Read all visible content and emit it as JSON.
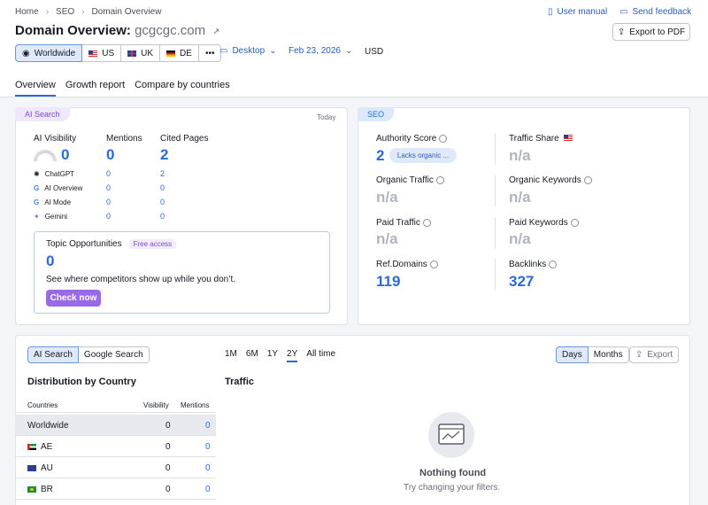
{
  "breadcrumb": [
    "Home",
    "SEO",
    "Domain Overview"
  ],
  "header": {
    "user_manual": "User manual",
    "send_feedback": "Send feedback",
    "title": "Domain Overview:",
    "domain": "gcgcgc.com",
    "export_pdf": "Export to PDF"
  },
  "databases": [
    {
      "label": "Worldwide",
      "icon": "globe-icon"
    },
    {
      "label": "US",
      "icon": "flag-us"
    },
    {
      "label": "UK",
      "icon": "flag-uk"
    },
    {
      "label": "DE",
      "icon": "flag-de"
    }
  ],
  "filters": {
    "device": "Desktop",
    "date": "Feb 23, 2026",
    "currency": "USD"
  },
  "tabs": [
    "Overview",
    "Growth report",
    "Compare by countries"
  ],
  "ai_search": {
    "tag": "AI Search",
    "today": "Today",
    "visibility_label": "AI Visibility",
    "visibility_value": "0",
    "mentions_label": "Mentions",
    "mentions_value": "0",
    "cited_label": "Cited Pages",
    "cited_value": "2",
    "sources": [
      {
        "name": "ChatGPT",
        "mentions": "0",
        "cited": "2"
      },
      {
        "name": "AI Overview",
        "mentions": "0",
        "cited": "0"
      },
      {
        "name": "AI Mode",
        "mentions": "0",
        "cited": "0"
      },
      {
        "name": "Gemini",
        "mentions": "0",
        "cited": "0"
      }
    ],
    "topic": {
      "title": "Topic Opportunities",
      "badge": "Free access",
      "value": "0",
      "desc": "See where competitors show up while you don’t.",
      "cta": "Check now"
    }
  },
  "seo": {
    "tag": "SEO",
    "authority_label": "Authority Score",
    "authority_value": "2",
    "authority_badge": "Lacks organic ...",
    "traffic_share_label": "Traffic Share",
    "traffic_share_value": "n/a",
    "organic_traffic_label": "Organic Traffic",
    "organic_traffic_value": "n/a",
    "organic_keywords_label": "Organic Keywords",
    "organic_keywords_value": "n/a",
    "paid_traffic_label": "Paid Traffic",
    "paid_traffic_value": "n/a",
    "paid_keywords_label": "Paid Keywords",
    "paid_keywords_value": "n/a",
    "ref_domains_label": "Ref.Domains",
    "ref_domains_value": "119",
    "backlinks_label": "Backlinks",
    "backlinks_value": "327"
  },
  "bottom": {
    "source_toggle": [
      "AI Search",
      "Google Search"
    ],
    "periods": [
      "1M",
      "6M",
      "1Y",
      "2Y",
      "All time"
    ],
    "granularity": [
      "Days",
      "Months"
    ],
    "export": "Export",
    "distribution_title": "Distribution by Country",
    "traffic_title": "Traffic",
    "columns": [
      "Countries",
      "Visibility",
      "Mentions"
    ],
    "rows": [
      {
        "country": "Worldwide",
        "flag": "",
        "visibility": "0",
        "mentions": "0"
      },
      {
        "country": "AE",
        "flag": "flag-ae",
        "visibility": "0",
        "mentions": "0"
      },
      {
        "country": "AU",
        "flag": "flag-au",
        "visibility": "0",
        "mentions": "0"
      },
      {
        "country": "BR",
        "flag": "flag-br",
        "visibility": "0",
        "mentions": "0"
      }
    ],
    "nothing_found": "Nothing found",
    "nothing_hint": "Try changing your filters."
  }
}
